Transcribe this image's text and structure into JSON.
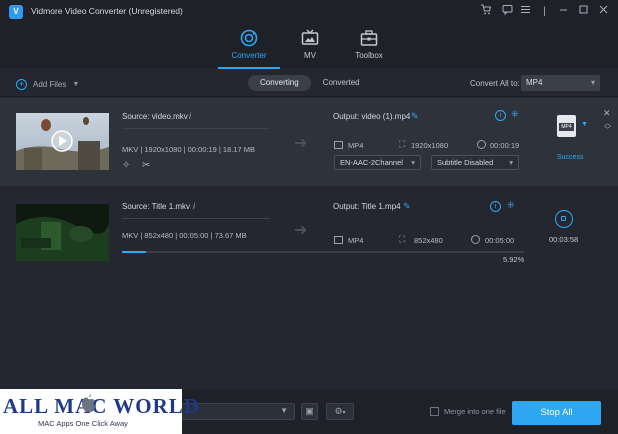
{
  "window": {
    "title": "Vidmore Video Converter (Unregistered)",
    "logo_text": "V"
  },
  "main_tabs": [
    {
      "label": "Converter",
      "icon": "converter-icon",
      "active": true
    },
    {
      "label": "MV",
      "icon": "tv-icon",
      "active": false
    },
    {
      "label": "Toolbox",
      "icon": "toolbox-icon",
      "active": false
    }
  ],
  "toolbar": {
    "add_files_label": "Add Files",
    "sub_tabs": [
      {
        "label": "Converting",
        "active": true
      },
      {
        "label": "Converted",
        "active": false
      }
    ],
    "convert_all_label": "Convert All to:",
    "convert_all_value": "MP4"
  },
  "files": [
    {
      "source": "Source: video.mkv",
      "source_meta": "MKV | 1920x1080 | 00:00:19 | 18.17 MB",
      "output": "Output: video (1).mp4",
      "out_format": "MP4",
      "out_resolution": "1920x1080",
      "out_duration": "00:00:19",
      "audio_track": "EN-AAC-2Channel",
      "subtitle": "Subtitle Disabled",
      "format_badge": "MP4",
      "status": "Success"
    },
    {
      "source": "Source: Title 1.mkv",
      "source_meta": "MKV | 852x480 | 00:05:00 | 73.67 MB",
      "output": "Output: Title 1.mp4",
      "out_format": "MP4",
      "out_resolution": "852x480",
      "out_duration": "00:05:00",
      "progress_text": "5.92%",
      "progress": 0.0592,
      "elapsed": "00:03:58"
    }
  ],
  "bottom": {
    "merge_label": "Merge into one file",
    "stop_all_label": "Stop All"
  },
  "watermark": {
    "text": "ALL MAC WORLD",
    "sub": "MAC Apps One Click Away"
  },
  "colors": {
    "accent": "#2ea7f2",
    "background": "#24272f",
    "row_highlight": "#2e323b"
  }
}
